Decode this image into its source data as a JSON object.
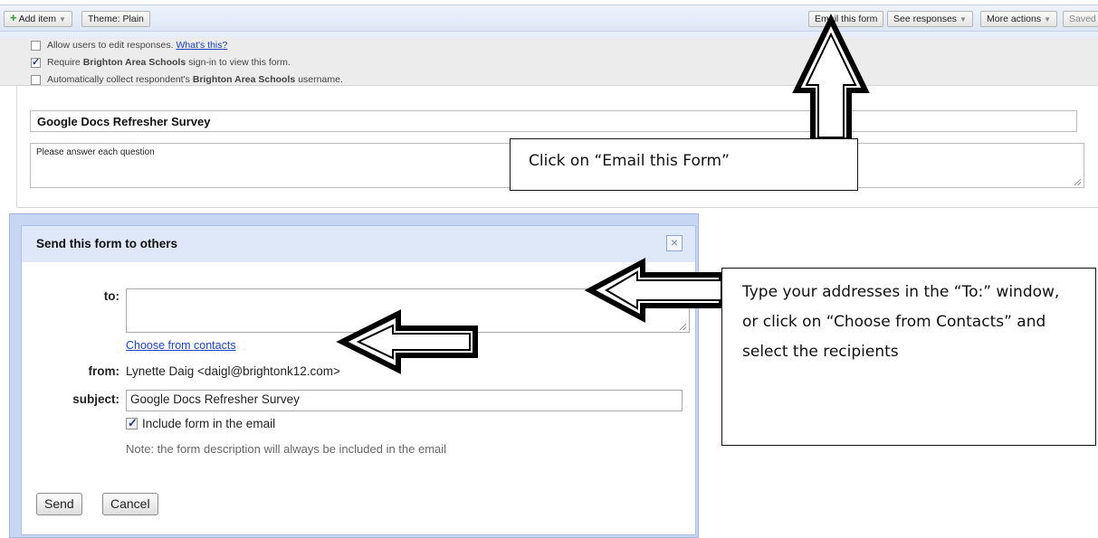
{
  "toolbar": {
    "add_item": "Add item",
    "theme": "Theme: Plain",
    "email_form": "Email this form",
    "see_responses": "See responses",
    "more_actions": "More actions",
    "saved": "Saved"
  },
  "settings": {
    "allow_edit": {
      "text": "Allow users to edit responses.",
      "link": "What's this?",
      "checked": false
    },
    "require_signin": {
      "pre": "Require",
      "org": "Brighton Area Schools",
      "post": "sign-in to view this form.",
      "checked": true
    },
    "collect_username": {
      "pre": "Automatically collect respondent's",
      "org": "Brighton Area Schools",
      "post": "username.",
      "checked": false
    }
  },
  "form": {
    "title": "Google Docs Refresher Survey",
    "description": "Please answer each question"
  },
  "dialog": {
    "title": "Send this form to others",
    "close_icon": "×",
    "to_label": "to:",
    "choose_contacts": "Choose from contacts",
    "from_label": "from:",
    "from_value": "Lynette Daig <daigl@brightonk12.com>",
    "subject_label": "subject:",
    "subject_value": "Google Docs Refresher Survey",
    "include_label": "Include form in the email",
    "note": "Note: the form description will always be included in the email",
    "send": "Send",
    "cancel": "Cancel"
  },
  "callouts": {
    "email_form": "Click on “Email this Form”",
    "to_window": "Type your addresses in the “To:” window, or click on “Choose from Contacts” and select the recipients"
  }
}
